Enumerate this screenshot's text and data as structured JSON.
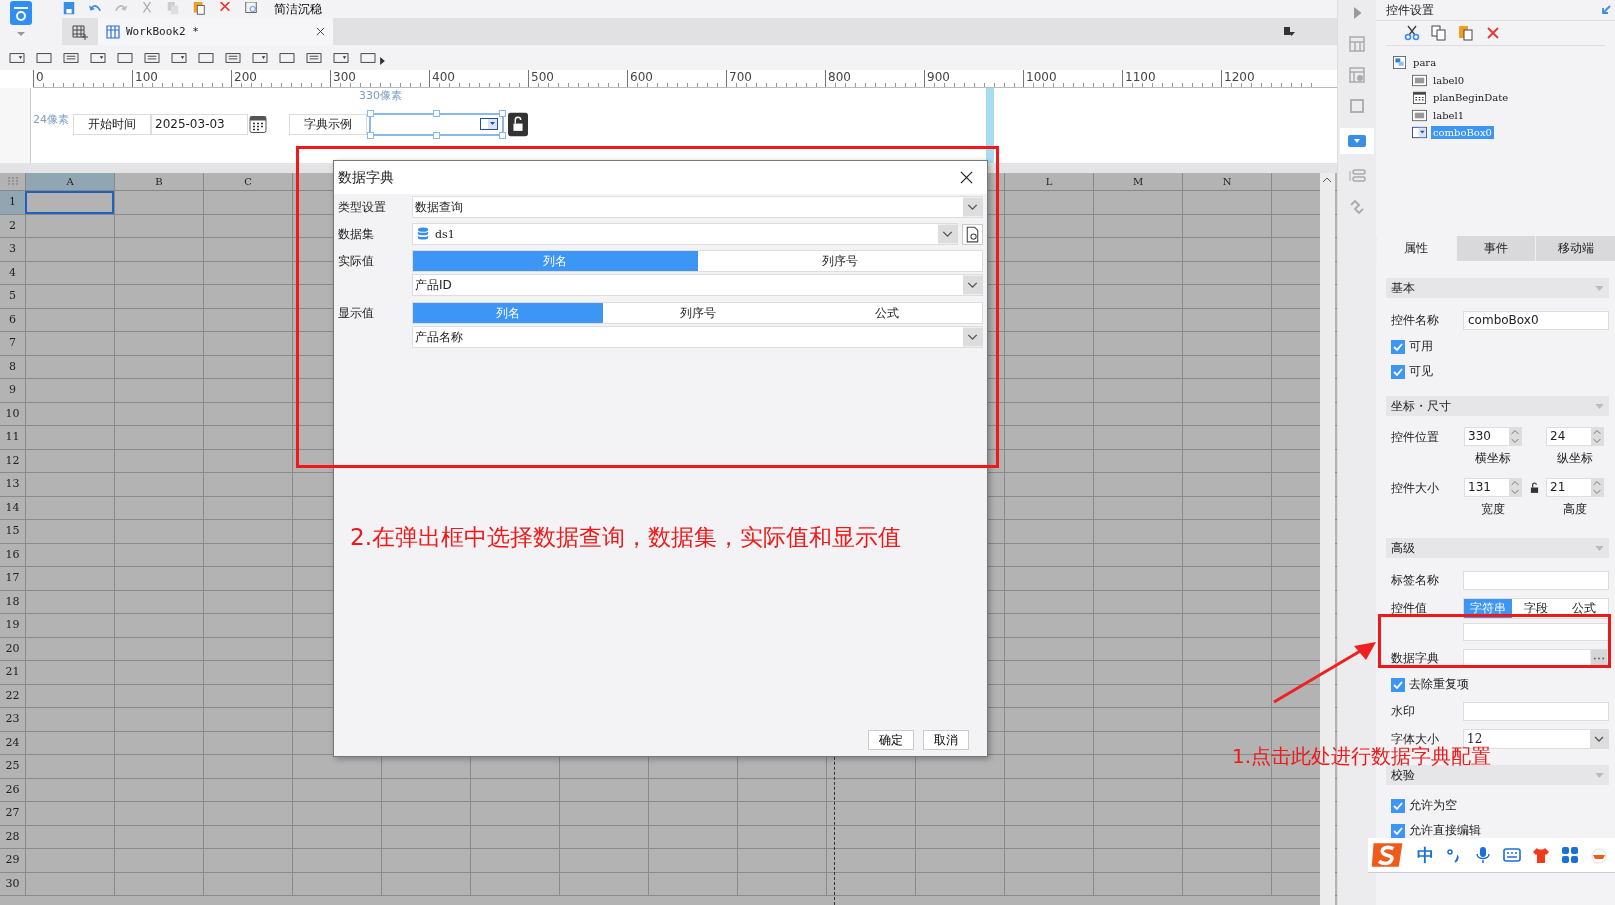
{
  "top_toolbar": {
    "theme_button": "简洁沉稳"
  },
  "tabs": [
    {
      "label": "WorkBook2 *",
      "selected": true
    }
  ],
  "ruler": {
    "marks": [
      "0",
      "100",
      "200",
      "300",
      "400",
      "500",
      "600",
      "700",
      "800",
      "900",
      "1000",
      "1100",
      "1200"
    ]
  },
  "param_pane": {
    "x_hint": "330像素",
    "y_hint": "24像素",
    "widgets": [
      {
        "kind": "label",
        "text": "开始时间"
      },
      {
        "kind": "date",
        "value": "2025-03-03"
      },
      {
        "kind": "label",
        "text": "字典示例"
      },
      {
        "kind": "combo",
        "selected": true
      }
    ]
  },
  "grid": {
    "columns_left": [
      {
        "label": "A",
        "selected": true
      },
      {
        "label": "B",
        "selected": false
      },
      {
        "label": "C",
        "selected": false
      }
    ],
    "columns_right": [
      {
        "label": "L",
        "selected": false
      },
      {
        "label": "M",
        "selected": false
      },
      {
        "label": "N",
        "selected": false
      }
    ],
    "rows": [
      {
        "label": "1",
        "selected": true
      },
      {
        "label": "2",
        "selected": false
      },
      {
        "label": "3",
        "selected": false
      },
      {
        "label": "4",
        "selected": false
      },
      {
        "label": "5",
        "selected": false
      },
      {
        "label": "6",
        "selected": false
      },
      {
        "label": "7",
        "selected": false
      },
      {
        "label": "8",
        "selected": false
      },
      {
        "label": "9",
        "selected": false
      },
      {
        "label": "10",
        "selected": false
      },
      {
        "label": "11",
        "selected": false
      },
      {
        "label": "12",
        "selected": false
      },
      {
        "label": "13",
        "selected": false
      },
      {
        "label": "14",
        "selected": false
      },
      {
        "label": "15",
        "selected": false
      },
      {
        "label": "16",
        "selected": false
      },
      {
        "label": "17",
        "selected": false
      },
      {
        "label": "18",
        "selected": false
      },
      {
        "label": "19",
        "selected": false
      },
      {
        "label": "20",
        "selected": false
      },
      {
        "label": "21",
        "selected": false
      },
      {
        "label": "22",
        "selected": false
      },
      {
        "label": "23",
        "selected": false
      },
      {
        "label": "24",
        "selected": false
      },
      {
        "label": "25",
        "selected": false
      },
      {
        "label": "26",
        "selected": false
      },
      {
        "label": "27",
        "selected": false
      },
      {
        "label": "28",
        "selected": false
      },
      {
        "label": "29",
        "selected": false
      },
      {
        "label": "30",
        "selected": false
      }
    ]
  },
  "dialog": {
    "title": "数据字典",
    "rows": [
      {
        "kind": "select",
        "label": "类型设置",
        "value": "数据查询"
      },
      {
        "kind": "dataset",
        "label": "数据集",
        "value": "ds1"
      },
      {
        "kind": "segments",
        "label": "实际值",
        "options": [
          {
            "label": "列名",
            "selected": true
          },
          {
            "label": "列序号",
            "selected": false
          }
        ]
      },
      {
        "kind": "select",
        "value": "产品ID"
      },
      {
        "kind": "segments",
        "label": "显示值",
        "options": [
          {
            "label": "列名",
            "selected": true
          },
          {
            "label": "列序号",
            "selected": false
          },
          {
            "label": "公式",
            "selected": false
          }
        ]
      },
      {
        "kind": "select",
        "value": "产品名称"
      }
    ],
    "buttons": [
      "确定",
      "取消"
    ]
  },
  "annotations": [
    {
      "text": "2.在弹出框中选择数据查询，数据集，实际值和显示值"
    },
    {
      "text": "1.点击此处进行数据字典配置"
    }
  ],
  "panel": {
    "title": "控件设置",
    "tree": {
      "label": "para",
      "children": [
        {
          "label": "label0",
          "kind": "label",
          "selected": false
        },
        {
          "label": "planBeginDate",
          "kind": "date",
          "selected": false
        },
        {
          "label": "label1",
          "kind": "label",
          "selected": false
        },
        {
          "label": "comboBox0",
          "kind": "combo",
          "selected": true
        }
      ]
    },
    "tabs": [
      {
        "label": "属性",
        "selected": true
      },
      {
        "label": "事件",
        "selected": false
      },
      {
        "label": "移动端",
        "selected": false
      }
    ],
    "sections": [
      {
        "title": "基本",
        "rows": [
          {
            "kind": "input",
            "label": "控件名称",
            "value": "comboBox0"
          },
          {
            "kind": "check",
            "label": "可用",
            "checked": true
          },
          {
            "kind": "check",
            "label": "可见",
            "checked": true
          }
        ]
      },
      {
        "title": "坐标・尺寸",
        "rows": [
          {
            "kind": "pair",
            "label": "控件位置",
            "lock_icon": false,
            "first": {
              "value": "330",
              "caption": "横坐标"
            },
            "second": {
              "value": "24",
              "caption": "纵坐标"
            }
          },
          {
            "kind": "pair",
            "label": "控件大小",
            "lock_icon": true,
            "first": {
              "value": "131",
              "caption": "宽度"
            },
            "second": {
              "value": "21",
              "caption": "高度"
            }
          }
        ]
      },
      {
        "title": "高级",
        "rows": [
          {
            "kind": "input",
            "label": "标签名称"
          },
          {
            "kind": "segments",
            "label": "控件值",
            "options": [
              {
                "label": "字符串",
                "selected": true
              },
              {
                "label": "字段",
                "selected": false
              },
              {
                "label": "公式",
                "selected": false
              }
            ]
          },
          {
            "kind": "picker",
            "label": "数据字典"
          },
          {
            "kind": "check",
            "label": "去除重复项",
            "checked": true
          },
          {
            "kind": "input",
            "label": "水印"
          },
          {
            "kind": "select",
            "label": "字体大小",
            "value": "12"
          }
        ]
      },
      {
        "title": "校验",
        "rows": [
          {
            "kind": "check",
            "label": "允许为空",
            "checked": true
          },
          {
            "kind": "check",
            "label": "允许直接编辑",
            "checked": true
          }
        ]
      }
    ]
  },
  "ime_bar": {
    "label": "中"
  }
}
